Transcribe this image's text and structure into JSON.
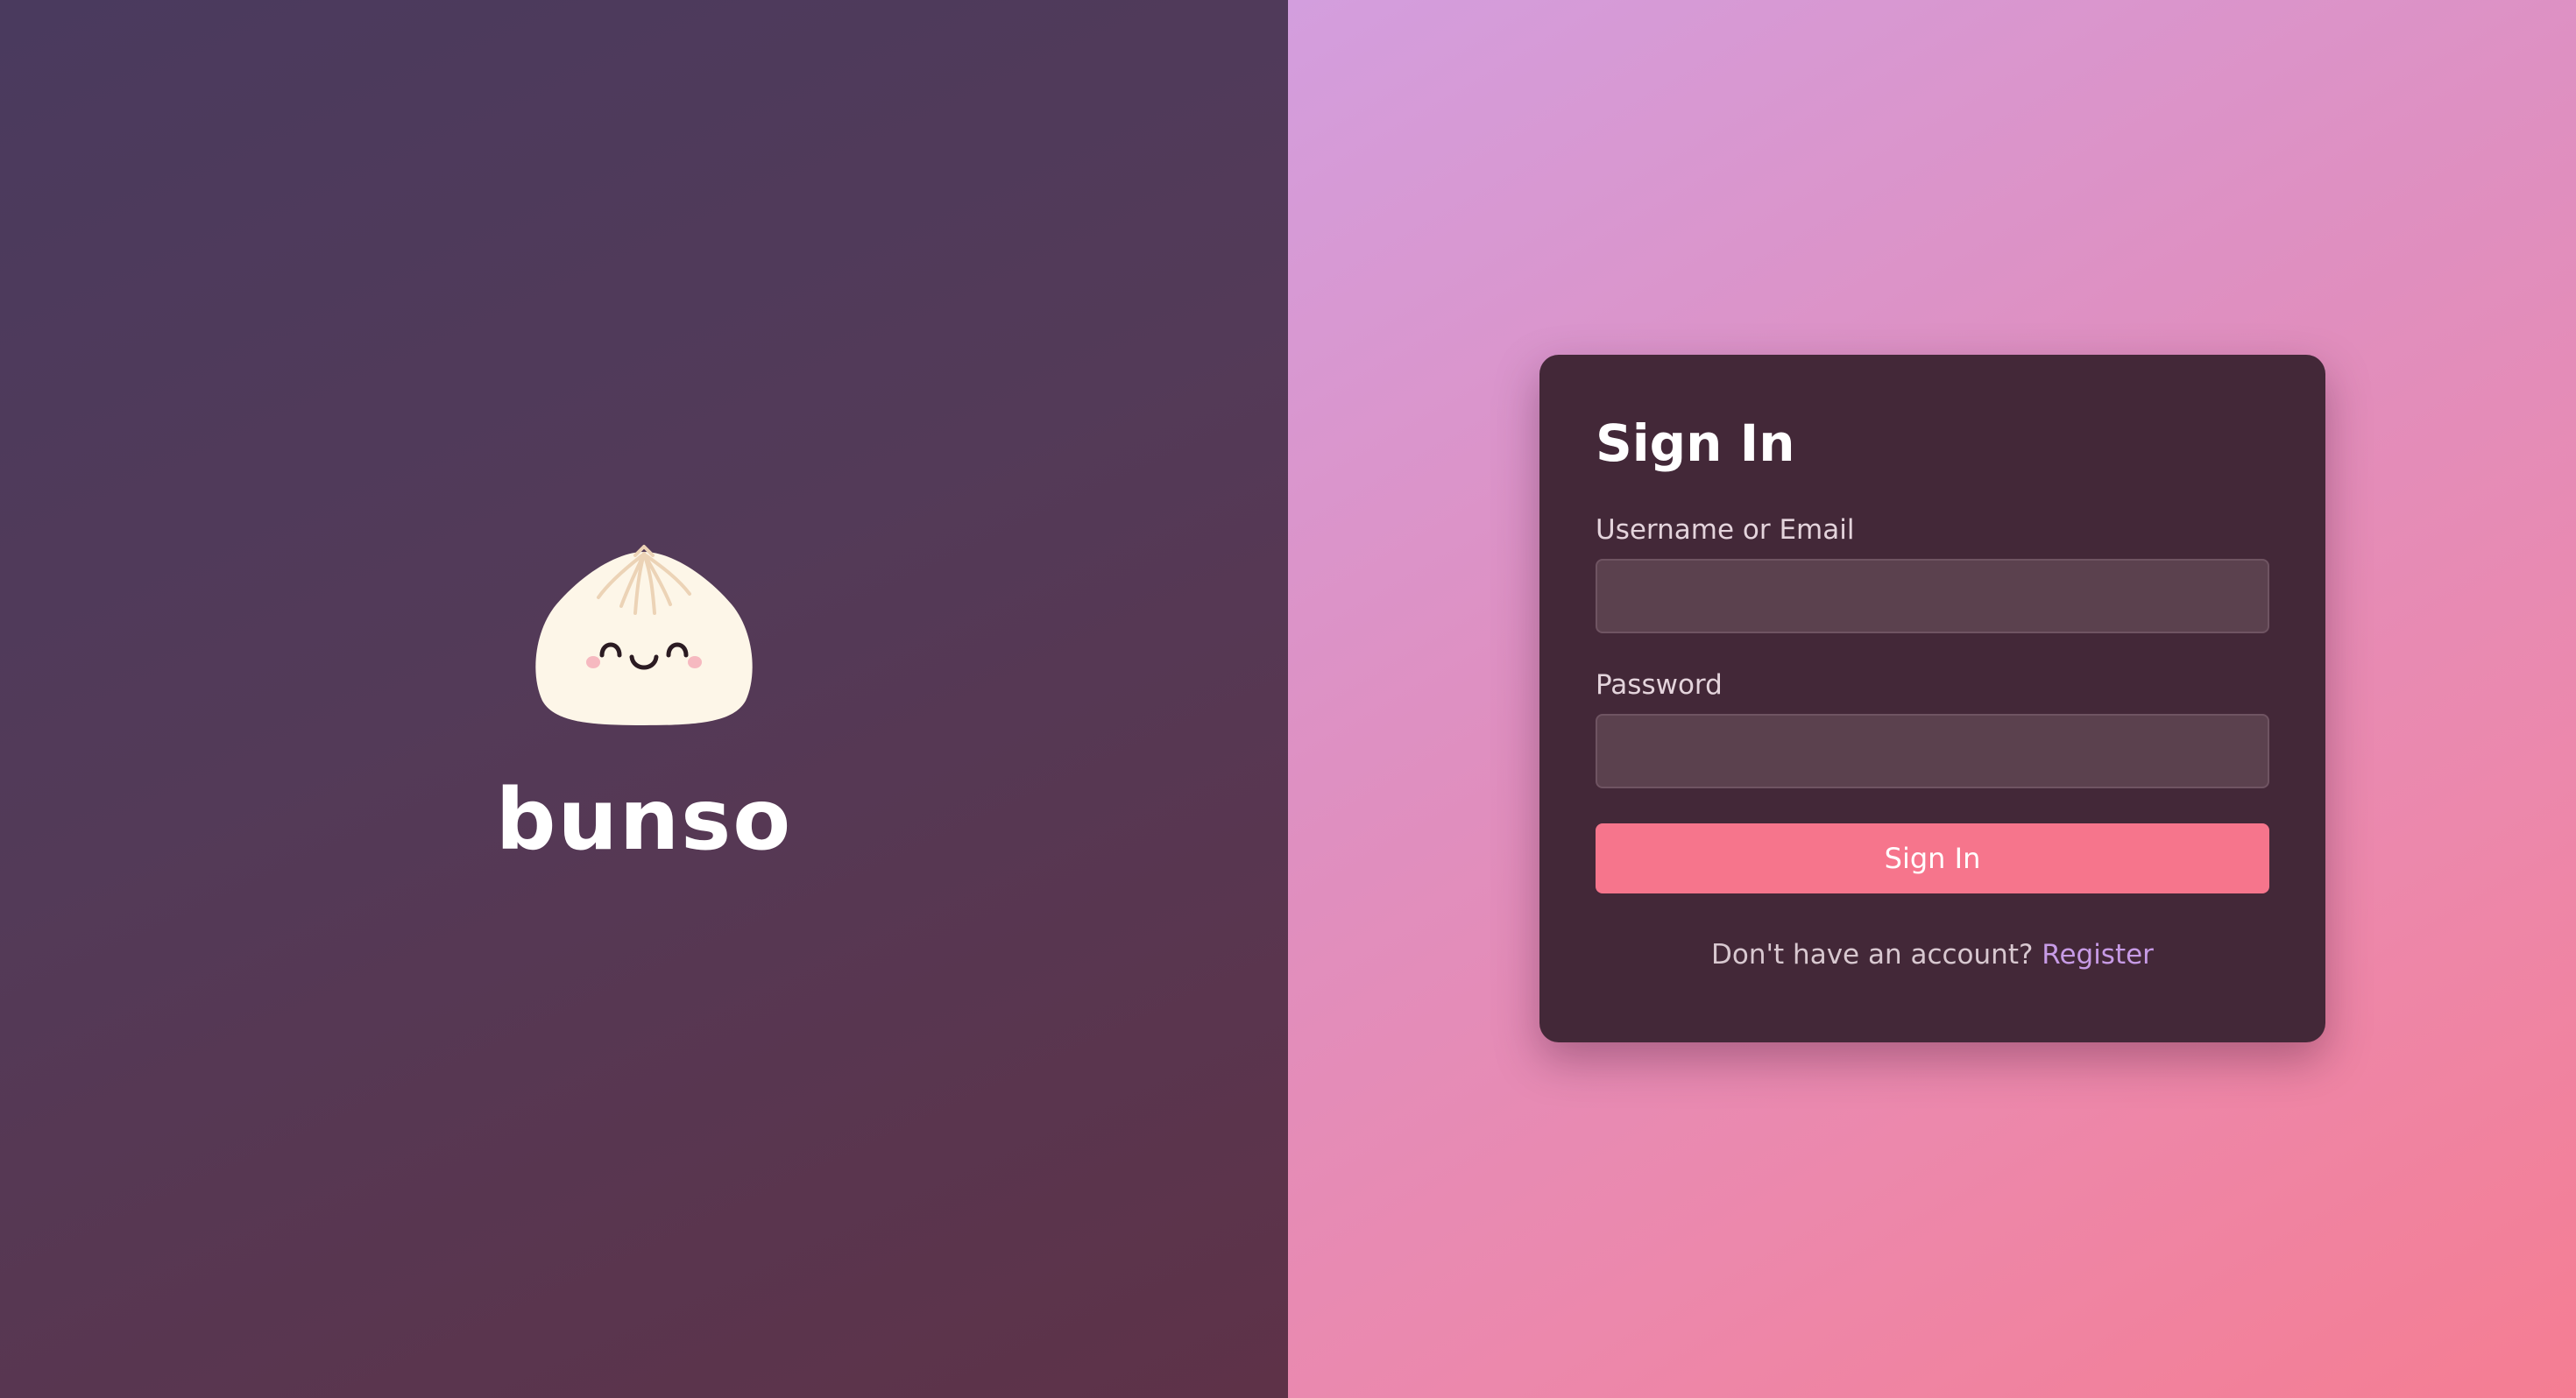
{
  "brand": {
    "name": "bunso",
    "logo_icon": "bun-mascot-icon"
  },
  "login": {
    "title": "Sign In",
    "username_label": "Username or Email",
    "username_value": "",
    "password_label": "Password",
    "password_value": "",
    "submit_label": "Sign In",
    "register_prompt": "Don't have an account?",
    "register_link": "Register"
  },
  "colors": {
    "left_panel": "#4f3a5a",
    "right_gradient_start": "#d39ede",
    "right_gradient_end": "#f57d92",
    "card_background": "#432838",
    "input_background": "#5b414e",
    "button": "#f6758c",
    "link": "#c79be6",
    "logo_bun": "#fdf6e8"
  }
}
